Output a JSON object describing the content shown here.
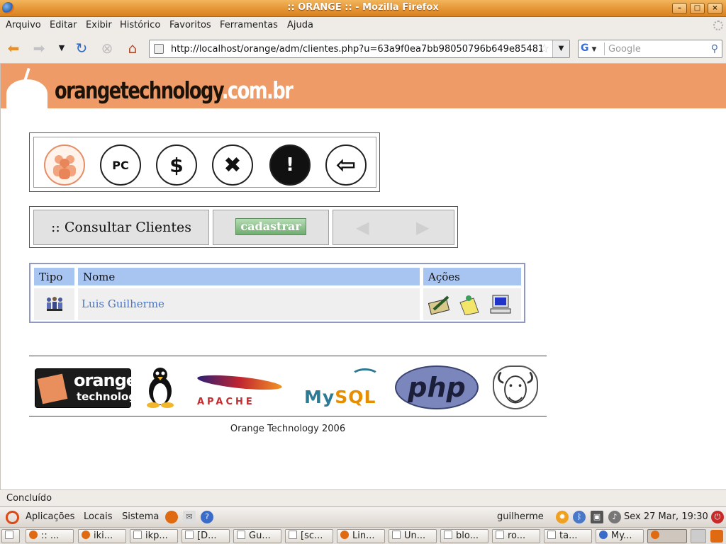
{
  "window": {
    "title": ":: ORANGE :: - Mozilla Firefox",
    "controls": {
      "minimize": "–",
      "maximize": "□",
      "close": "×"
    }
  },
  "menu": [
    "Arquivo",
    "Editar",
    "Exibir",
    "Histórico",
    "Favoritos",
    "Ferramentas",
    "Ajuda"
  ],
  "nav": {
    "url": "http://localhost/orange/adm/clientes.php?u=63a9f0ea7bb98050796b649e85481",
    "search_placeholder": "Google",
    "search_engine": "G",
    "icons": [
      "back-icon",
      "forward-icon",
      "history-dropdown-icon",
      "reload-icon",
      "stop-icon",
      "home-icon"
    ]
  },
  "site": {
    "brand_main": "orangetechnology",
    "brand_domain": ".com.br",
    "toolbar_icons": [
      "clients-icon",
      "pc-icon",
      "money-icon",
      "tools-icon",
      "alert-icon",
      "logout-icon"
    ],
    "toolbar_glyphs": {
      "pc": "PC",
      "money": "$",
      "tools": "✖",
      "alert": "!",
      "logout": "⇦"
    },
    "tabs": {
      "title": ":: Consultar Clientes",
      "cadastrar": "cadastrar",
      "prev": "◀",
      "next": "▶"
    },
    "table": {
      "headers": [
        "Tipo",
        "Nome",
        "Ações"
      ],
      "rows": [
        {
          "tipo_icon": "users-group-icon",
          "nome": "Luis Guilherme",
          "acoes": [
            "edit-icon",
            "notes-icon",
            "computer-icon"
          ]
        }
      ]
    },
    "footer": {
      "logos": [
        "orange technology",
        "Tux",
        "APACHE",
        "MySQL",
        "php",
        "GNU"
      ],
      "orange_logo_top": "orange",
      "orange_logo_bottom": "technology",
      "apache_word": "APACHE",
      "mysql_my": "My",
      "mysql_sql": "SQL",
      "php_word": "php",
      "copyright": "Orange Technology 2006"
    }
  },
  "status": "Concluído",
  "panel": {
    "menus": [
      "Aplicações",
      "Locais",
      "Sistema"
    ],
    "user": "guilherme",
    "clock": "Sex 27 Mar, 19:30"
  },
  "taskbar": [
    ":: ...",
    "iki...",
    "ikp...",
    "[D...",
    "Gu...",
    "[sc...",
    "Lin...",
    "Un...",
    "blo...",
    "ro...",
    "ta...",
    "My..."
  ],
  "colors": {
    "banner": "#ef9b68",
    "table_header": "#a8c4f0",
    "table_border": "#8f98c6",
    "link": "#4a76c2",
    "titlebar": "#e59535"
  }
}
